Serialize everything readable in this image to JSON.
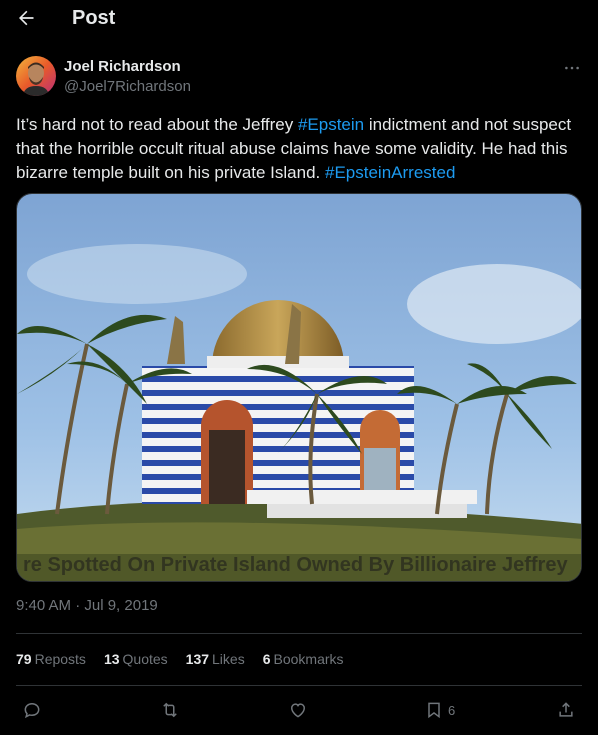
{
  "header": {
    "title": "Post"
  },
  "author": {
    "name": "Joel Richardson",
    "handle": "@Joel7Richardson"
  },
  "post": {
    "text_1": "It’s hard not to read about the Jeffrey ",
    "hashtag_1": "#Epstein",
    "text_2": " indictment and not suspect that the horrible occult ritual abuse claims have some validity. He had this bizarre temple built on his private Island.  ",
    "hashtag_2": "#EpsteinArrested"
  },
  "media": {
    "caption": "re Spotted On Private Island Owned By Billionaire Jeffrey"
  },
  "meta": {
    "timestamp": "9:40 AM · Jul 9, 2019"
  },
  "stats": [
    {
      "count": "79",
      "label": "Reposts"
    },
    {
      "count": "13",
      "label": "Quotes"
    },
    {
      "count": "137",
      "label": "Likes"
    },
    {
      "count": "6",
      "label": "Bookmarks"
    }
  ],
  "actions": {
    "bookmark_count": "6"
  },
  "colors": {
    "background": "#000000",
    "text": "#e7e9ea",
    "muted": "#71767b",
    "accent": "#1d9bf0",
    "border": "#2f3336"
  }
}
